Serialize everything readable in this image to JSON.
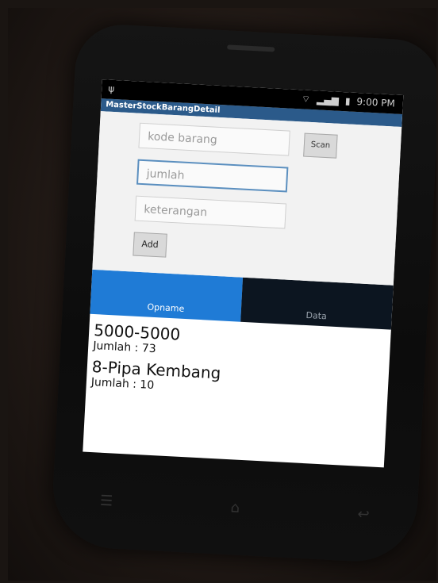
{
  "status_bar": {
    "time": "9:00 PM",
    "icons": [
      "usb-icon",
      "wifi-icon",
      "signal-icon",
      "battery-icon"
    ]
  },
  "app": {
    "title": "MasterStockBarangDetail"
  },
  "form": {
    "kode_barang_placeholder": "kode barang",
    "scan_label": "Scan",
    "jumlah_placeholder": "jumlah",
    "keterangan_placeholder": "keterangan",
    "add_label": "Add"
  },
  "tabs": [
    {
      "label": "Opname",
      "active": true
    },
    {
      "label": "Data",
      "active": false
    }
  ],
  "list_items": [
    {
      "title": "5000-5000",
      "detail": "Jumlah : 73"
    },
    {
      "title": "8-Pipa Kembang",
      "detail": "Jumlah : 10"
    }
  ],
  "colors": {
    "active_tab": "#1f7bd6",
    "titlebar": "#2b5a8a"
  }
}
